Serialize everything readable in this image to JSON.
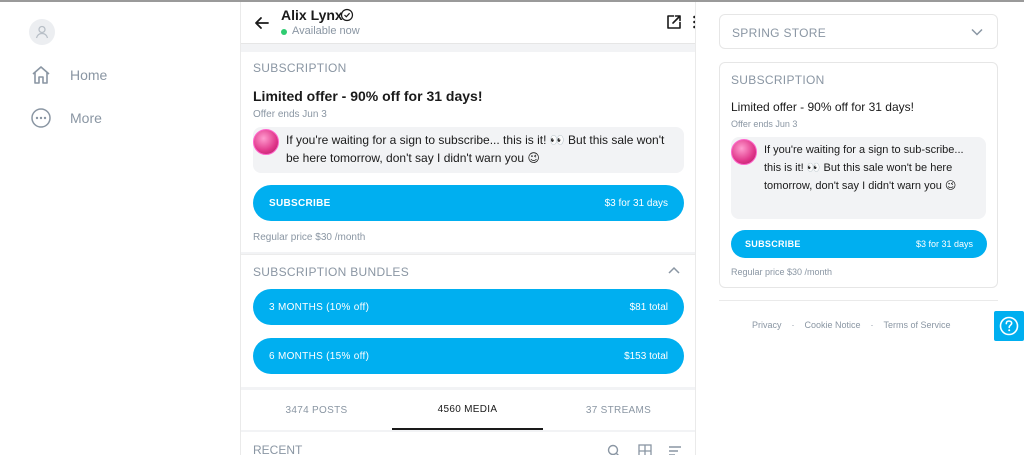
{
  "nav": {
    "home_label": "Home",
    "more_label": "More"
  },
  "profile": {
    "name": "Alix Lynx",
    "status": "Available now"
  },
  "subscription": {
    "section_title": "SUBSCRIPTION",
    "offer_title": "Limited offer - 90% off for 31 days!",
    "offer_ends": "Offer ends Jun 3",
    "message": "If you're waiting for a sign to subscribe... this is it! 👀 But this sale won't be here tomorrow, don't say I didn't warn you 😉",
    "subscribe_label": "SUBSCRIBE",
    "subscribe_price": "$3 for 31 days",
    "regular_price": "Regular price $30 /month"
  },
  "bundles": {
    "section_title": "SUBSCRIPTION BUNDLES",
    "items": [
      {
        "label": "3 MONTHS (10% off)",
        "price": "$81 total"
      },
      {
        "label": "6 MONTHS (15% off)",
        "price": "$153 total"
      }
    ]
  },
  "tabs": [
    {
      "label": "3474 POSTS",
      "active": false
    },
    {
      "label": "4560 MEDIA",
      "active": true
    },
    {
      "label": "37 STREAMS",
      "active": false
    }
  ],
  "recent_label": "RECENT",
  "store": {
    "select_label": "SPRING STORE"
  },
  "right_subscription": {
    "section_title": "SUBSCRIPTION",
    "offer_title": "Limited offer - 90% off for 31 days!",
    "offer_ends": "Offer ends Jun 3",
    "message": "If you're waiting for a sign to sub-scribe... this is it! 👀 But this sale won't be here tomorrow, don't say I didn't warn you 😉",
    "subscribe_label": "SUBSCRIBE",
    "subscribe_price": "$3 for 31 days",
    "regular_price": "Regular price $30 /month"
  },
  "footer": {
    "privacy": "Privacy",
    "cookie": "Cookie Notice",
    "terms": "Terms of Service",
    "separator": "·"
  },
  "colors": {
    "accent": "#00aff0",
    "muted": "#8a96a3",
    "online": "#2fcc71"
  }
}
